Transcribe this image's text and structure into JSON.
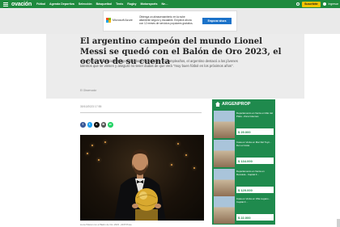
{
  "nav": {
    "logo": "ovación",
    "items": [
      "Fútbol",
      "Agenda Deportiva",
      "Selección",
      "Básquetbol",
      "Tenis",
      "Rugby",
      "Motorsports",
      "Ne…"
    ],
    "subscribe_label": "Suscribite",
    "login_label": "Ingresar"
  },
  "top_ad": {
    "brand": "Microsoft Azure",
    "text": "Obtenga un almacenamiento en la nube altamente seguro y escalable. Empiece ahora con 12 meses de servicios populares gratuitos.",
    "cta": "Empezar ahora"
  },
  "article": {
    "headline": "El argentino campeón del mundo Lionel Messi se quedó con el Balón de Oro 2023, el octavo de su cuenta",
    "summary": "Con mención especial a Diego Maradona en el día de su cumpleaños, el argentino destacó a los jóvenes talentos que se vienen y aseguró no tener dudas de que verá \"muy buen fútbol en los próximos años\".",
    "byline": "El Observador",
    "date": "30/10/2023 17:55",
    "share_buttons": [
      {
        "icon": "facebook-icon",
        "glyph": "f",
        "color": "#3b5998"
      },
      {
        "icon": "twitter-icon",
        "glyph": "t",
        "color": "#1da1f2"
      },
      {
        "icon": "x-icon",
        "glyph": "x",
        "color": "#111111"
      },
      {
        "icon": "mail-icon",
        "glyph": "✉",
        "color": "#555555"
      },
      {
        "icon": "whatsapp-icon",
        "glyph": "w",
        "color": "#25d366"
      }
    ],
    "photo_caption": "Lionel Messi con el Balón de Oro 2023 - AFP Photo"
  },
  "side_ad": {
    "brand": "ARGENPROP",
    "listings": [
      {
        "title": "Departamento en Venta en Mar del Plata - Zona Güemes",
        "price": "$ 29.000"
      },
      {
        "title": "Casa en Venta en Mar Del Tuyú - De La Costa",
        "price": "$ 134.000"
      },
      {
        "title": "Departamento en Venta en Recoleta - Capital F…",
        "price": "$ 129.000"
      },
      {
        "title": "Casa en Venta en Villa Lugano - Capital F…",
        "price": "$ 22.000"
      }
    ]
  },
  "colors": {
    "brand_green": "#1f8a3e",
    "subscribe_yellow": "#f5c400",
    "hero_bg": "#ececec",
    "sidead_green": "#1f8a4d"
  }
}
